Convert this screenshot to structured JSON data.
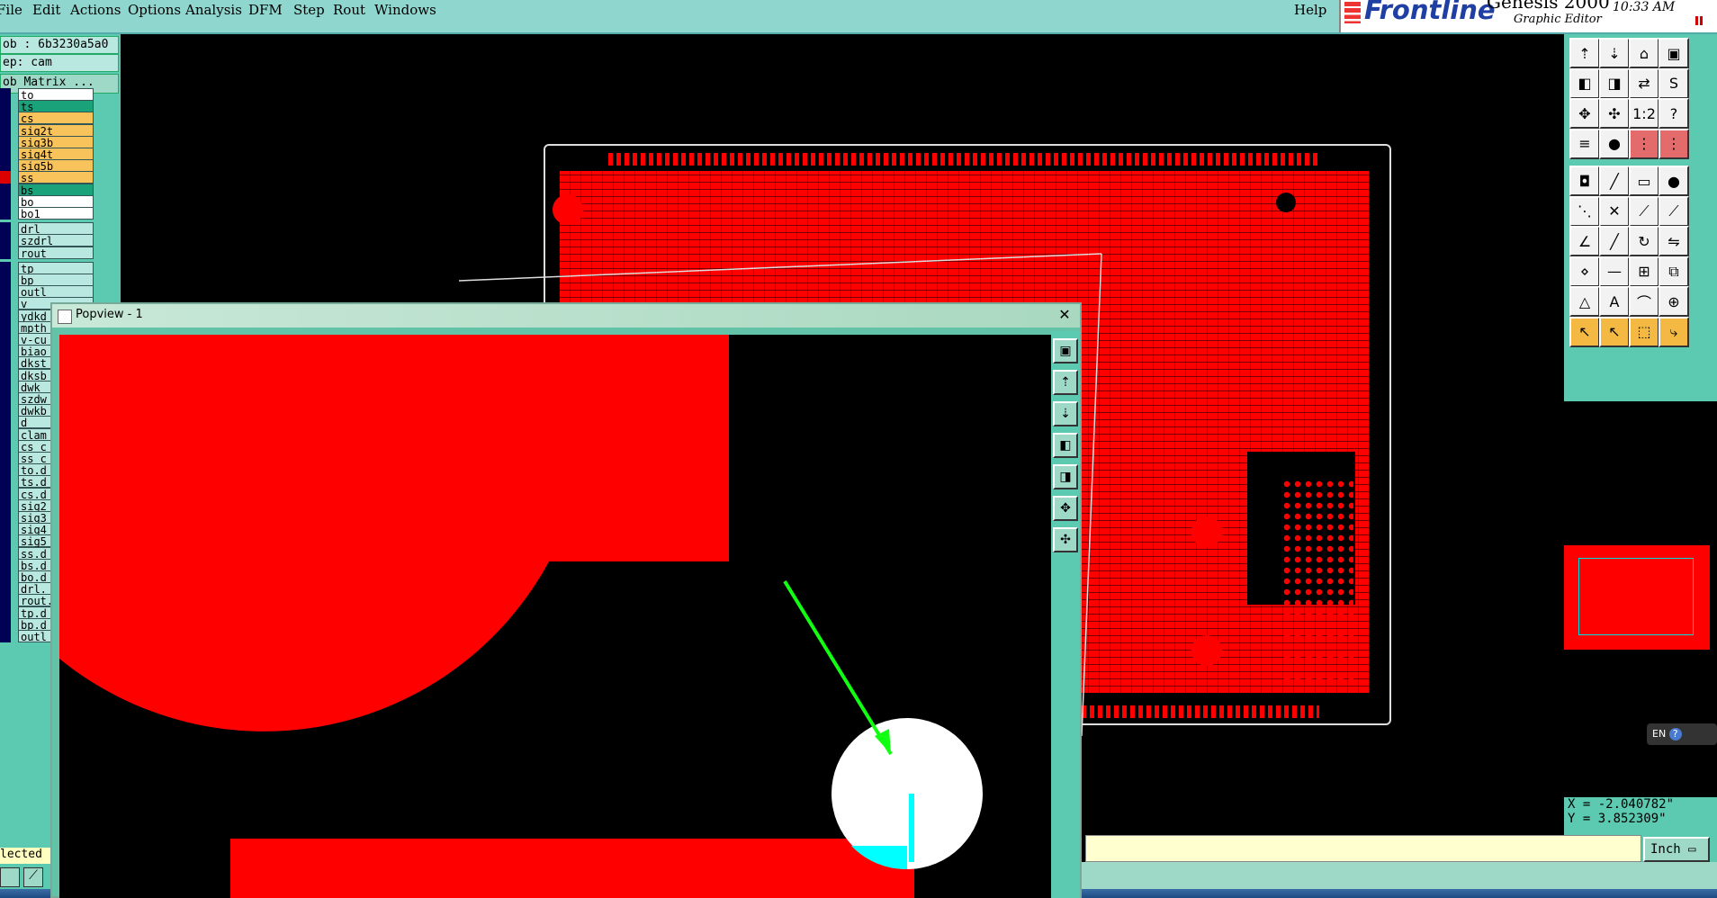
{
  "menu": {
    "items": [
      "File",
      "Edit",
      "Actions",
      "Options",
      "Analysis",
      "DFM",
      "Step",
      "Rout",
      "Windows"
    ],
    "help": "Help"
  },
  "branding": {
    "logo": "Frontline",
    "title": "Genesis 2000",
    "subtitle": "Graphic Editor",
    "time": "10:33 AM"
  },
  "job_panel": {
    "job": "ob : 6b3230a5a0",
    "step": "ep: cam",
    "matrix_button": "ob Matrix ...",
    "selected_label": "lected"
  },
  "layers": [
    {
      "name": "to",
      "color": "#ffffff"
    },
    {
      "name": "ts",
      "color": "#1aa37a"
    },
    {
      "name": "cs",
      "color": "#f7c35a"
    },
    {
      "name": "sig2t",
      "color": "#f7c35a"
    },
    {
      "name": "sig3b",
      "color": "#f7c35a"
    },
    {
      "name": "sig4t",
      "color": "#f7c35a"
    },
    {
      "name": "sig5b",
      "color": "#f7c35a"
    },
    {
      "name": "ss",
      "color": "#f7c35a"
    },
    {
      "name": "bs",
      "color": "#1aa37a"
    },
    {
      "name": "bo",
      "color": "#ffffff"
    },
    {
      "name": "bo1",
      "color": "#ffffff"
    },
    {
      "name": "drl",
      "color": "#b8e8e0"
    },
    {
      "name": "szdrl",
      "color": "#b8e8e0"
    },
    {
      "name": "rout",
      "color": "#b8e8e0"
    },
    {
      "name": "tp",
      "color": "#b8e8e0"
    },
    {
      "name": "bp",
      "color": "#b8e8e0"
    },
    {
      "name": "outl",
      "color": "#b8e8e0"
    },
    {
      "name": "v",
      "color": "#b8e8e0"
    },
    {
      "name": "ydkd",
      "color": "#b8e8e0"
    },
    {
      "name": "mpth",
      "color": "#b8e8e0"
    },
    {
      "name": "v-cu",
      "color": "#b8e8e0"
    },
    {
      "name": "biao",
      "color": "#b8e8e0"
    },
    {
      "name": "dkst",
      "color": "#b8e8e0"
    },
    {
      "name": "dksb",
      "color": "#b8e8e0"
    },
    {
      "name": "dwk",
      "color": "#b8e8e0"
    },
    {
      "name": "szdw",
      "color": "#b8e8e0"
    },
    {
      "name": "dwkb",
      "color": "#b8e8e0"
    },
    {
      "name": "d",
      "color": "#b8e8e0"
    },
    {
      "name": "clam",
      "color": "#b8e8e0"
    },
    {
      "name": "cs_c",
      "color": "#b8e8e0"
    },
    {
      "name": "ss_c",
      "color": "#b8e8e0"
    },
    {
      "name": "to.d",
      "color": "#b8e8e0"
    },
    {
      "name": "ts.d",
      "color": "#b8e8e0"
    },
    {
      "name": "cs.d",
      "color": "#b8e8e0"
    },
    {
      "name": "sig2",
      "color": "#b8e8e0"
    },
    {
      "name": "sig3",
      "color": "#b8e8e0"
    },
    {
      "name": "sig4",
      "color": "#b8e8e0"
    },
    {
      "name": "sig5",
      "color": "#b8e8e0"
    },
    {
      "name": "ss.d",
      "color": "#b8e8e0"
    },
    {
      "name": "bs.d",
      "color": "#b8e8e0"
    },
    {
      "name": "bo.d",
      "color": "#b8e8e0"
    },
    {
      "name": "drl.",
      "color": "#b8e8e0"
    },
    {
      "name": "rout.",
      "color": "#b8e8e0"
    },
    {
      "name": "tp.d",
      "color": "#b8e8e0"
    },
    {
      "name": "bp.d",
      "color": "#b8e8e0"
    },
    {
      "name": "outl",
      "color": "#b8e8e0"
    }
  ],
  "toolbar_buttons": [
    {
      "icon": "layer-up-icon",
      "glyph": "⇡",
      "style": "white"
    },
    {
      "icon": "layer-down-icon",
      "glyph": "⇣",
      "style": "white"
    },
    {
      "icon": "home-icon",
      "glyph": "⌂",
      "style": "white"
    },
    {
      "icon": "window-icon",
      "glyph": "▣",
      "style": "white"
    },
    {
      "icon": "pan-left-icon",
      "glyph": "◧",
      "style": "white"
    },
    {
      "icon": "pan-right-icon",
      "glyph": "◨",
      "style": "white"
    },
    {
      "icon": "swap-icon",
      "glyph": "⇄",
      "style": "white"
    },
    {
      "icon": "snap-icon",
      "glyph": "S",
      "style": "white"
    },
    {
      "icon": "zoom-fit-icon",
      "glyph": "✥",
      "style": "white"
    },
    {
      "icon": "zoom-center-icon",
      "glyph": "✣",
      "style": "white"
    },
    {
      "icon": "zoom-1to2-icon",
      "glyph": "1:2",
      "style": "white"
    },
    {
      "icon": "help-icon",
      "glyph": "?",
      "style": "white"
    },
    {
      "icon": "measure-icon",
      "glyph": "≡",
      "style": "white"
    },
    {
      "icon": "pin-icon",
      "glyph": "●",
      "style": "white"
    },
    {
      "icon": "layers-icon",
      "glyph": "⋮",
      "style": "red"
    },
    {
      "icon": "layers-red-icon",
      "glyph": "⋮",
      "style": "red"
    },
    {
      "icon": "pad-icon",
      "glyph": "◘",
      "style": "white"
    },
    {
      "icon": "line-icon",
      "glyph": "╱",
      "style": "white"
    },
    {
      "icon": "ruler-icon",
      "glyph": "▭",
      "style": "white"
    },
    {
      "icon": "dot-icon",
      "glyph": "●",
      "style": "white"
    },
    {
      "icon": "net-icon",
      "glyph": "⋱",
      "style": "white"
    },
    {
      "icon": "cross-icon",
      "glyph": "✕",
      "style": "white"
    },
    {
      "icon": "connect-icon",
      "glyph": "⟋",
      "style": "white"
    },
    {
      "icon": "branch-icon",
      "glyph": "⟋",
      "style": "white"
    },
    {
      "icon": "angle-icon",
      "glyph": "∠",
      "style": "white"
    },
    {
      "icon": "slash-icon",
      "glyph": "╱",
      "style": "white"
    },
    {
      "icon": "rotate-icon",
      "glyph": "↻",
      "style": "white"
    },
    {
      "icon": "mirror-icon",
      "glyph": "⇋",
      "style": "white"
    },
    {
      "icon": "node-icon",
      "glyph": "⋄",
      "style": "white"
    },
    {
      "icon": "minus-icon",
      "glyph": "—",
      "style": "white"
    },
    {
      "icon": "align-icon",
      "glyph": "⊞",
      "style": "white"
    },
    {
      "icon": "group-icon",
      "glyph": "⧉",
      "style": "white"
    },
    {
      "icon": "triangle-icon",
      "glyph": "△",
      "style": "white"
    },
    {
      "icon": "triangle-a-icon",
      "glyph": "A",
      "style": "white"
    },
    {
      "icon": "triangle-arc-icon",
      "glyph": "⌒",
      "style": "white"
    },
    {
      "icon": "triangle-plus-icon",
      "glyph": "⊕",
      "style": "white"
    },
    {
      "icon": "pointer-icon",
      "glyph": "↖",
      "style": "orange"
    },
    {
      "icon": "pointer-select-icon",
      "glyph": "↖",
      "style": "orange"
    },
    {
      "icon": "pointer-area-icon",
      "glyph": "⬚",
      "style": "orange"
    },
    {
      "icon": "pointer-path-icon",
      "glyph": "⤷",
      "style": "orange"
    }
  ],
  "coords": {
    "x": "X = -2.040782\"",
    "y": "Y = 3.852309\""
  },
  "unit_button": "Inch",
  "language": "EN",
  "popup": {
    "title": "Popview - 1",
    "close": "✕",
    "tools": [
      {
        "icon": "popup-fit-icon",
        "glyph": "▣"
      },
      {
        "icon": "popup-up-icon",
        "glyph": "⇡"
      },
      {
        "icon": "popup-down-icon",
        "glyph": "⇣"
      },
      {
        "icon": "popup-left-icon",
        "glyph": "◧"
      },
      {
        "icon": "popup-right-icon",
        "glyph": "◨"
      },
      {
        "icon": "popup-zoomout-icon",
        "glyph": "✥"
      },
      {
        "icon": "popup-zoomin-icon",
        "glyph": "✣"
      }
    ]
  }
}
